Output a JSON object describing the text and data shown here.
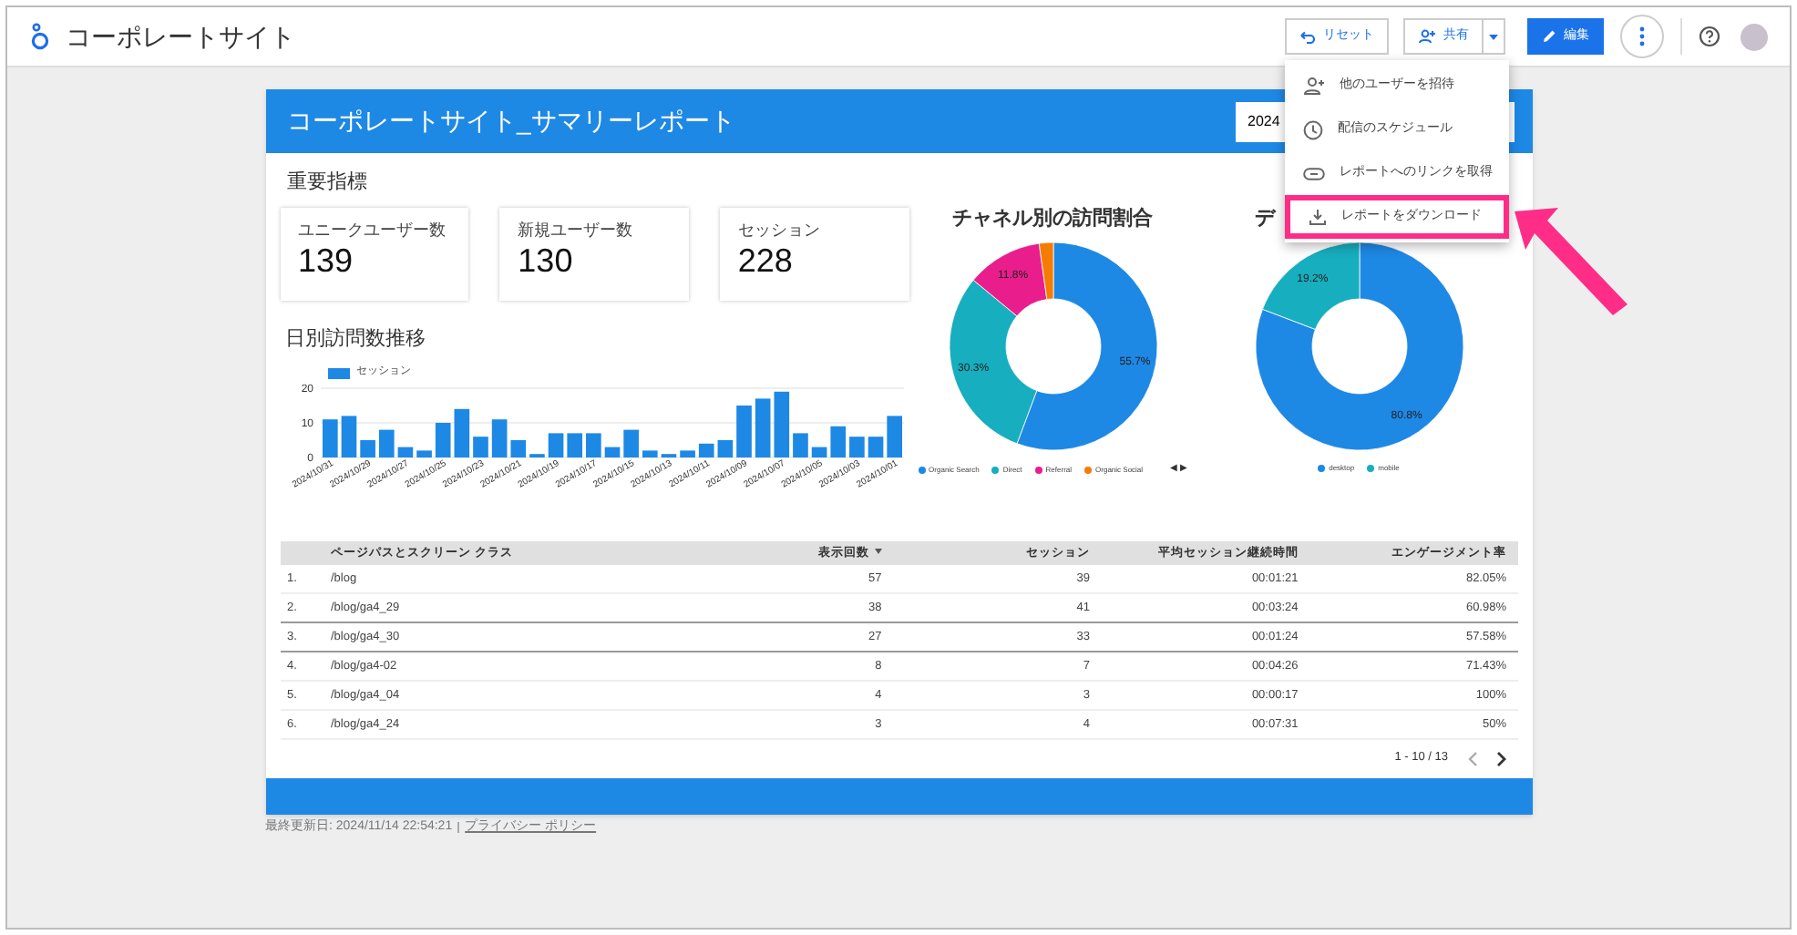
{
  "app_bar": {
    "title": "コーポレートサイト",
    "buttons": [
      {
        "kind": "reset",
        "label": "リセット"
      },
      {
        "kind": "share",
        "label": "共有"
      },
      {
        "kind": "edit",
        "label": "編集"
      }
    ]
  },
  "report": {
    "title": "コーポレートサイト_サマリーレポート",
    "date_range": "2024",
    "section_title": "重要指標",
    "scorecards": [
      {
        "label": "ユニークユーザー数",
        "value": "139"
      },
      {
        "label": "新規ユーザー数",
        "value": "130"
      },
      {
        "label": "セッション",
        "value": "228"
      }
    ],
    "bar_chart": {
      "title": "日別訪問数推移",
      "chart_data": {
        "type": "bar",
        "series": [
          {
            "name": "セッション",
            "color": "#1e88e5",
            "values": [
              11,
              12,
              5,
              8,
              3,
              2,
              10,
              14,
              6,
              11,
              5,
              1,
              7,
              7,
              7,
              3,
              8,
              2,
              1,
              2,
              4,
              5,
              15,
              17,
              19,
              7,
              3,
              9,
              6,
              6,
              12
            ]
          }
        ],
        "ylim": [
          0,
          20
        ],
        "yticks": [
          0,
          10,
          20
        ],
        "categories": [
          "2024/10/31",
          null,
          "2024/10/29",
          null,
          "2024/10/27",
          null,
          "2024/10/25",
          null,
          "2024/10/23",
          null,
          "2024/10/21",
          null,
          "2024/10/19",
          null,
          "2024/10/17",
          null,
          "2024/10/15",
          null,
          "2024/10/13",
          null,
          "2024/10/11",
          null,
          "2024/10/09",
          null,
          "2024/10/07",
          null,
          "2024/10/05",
          null,
          "2024/10/03",
          null,
          "2024/10/01"
        ]
      }
    },
    "donuts": [
      {
        "title": "チャネル別の訪問割合",
        "chart_data": {
          "type": "donut",
          "categories": [
            "Organic Search",
            "Direct",
            "Referral",
            "Organic Social"
          ],
          "values": [
            55.7,
            30.3,
            11.8,
            2.2
          ],
          "value_labels": [
            "55.7%",
            "30.3%",
            "11.8%",
            null
          ]
        },
        "slices": [
          {
            "color": "#1e88e5"
          },
          {
            "color": "#17aebf"
          },
          {
            "color": "#e91e8c"
          },
          {
            "color": "#f57c00"
          }
        ],
        "legend_pager": "◀ ▶"
      },
      {
        "title": "デ",
        "chart_data": {
          "type": "donut",
          "categories": [
            "desktop",
            "mobile"
          ],
          "values": [
            80.8,
            19.2
          ],
          "value_labels": [
            "80.8%",
            "19.2%"
          ]
        },
        "slices": [
          {
            "color": "#1e88e5"
          },
          {
            "color": "#17aebf"
          }
        ]
      }
    ],
    "table": {
      "columns": [
        {
          "label": "ページパスとスクリーン クラス",
          "sorted": false
        },
        {
          "label": "表示回数",
          "sorted": true
        },
        {
          "label": "セッション",
          "sorted": false
        },
        {
          "label": "平均セッション継続時間",
          "sorted": false
        },
        {
          "label": "エンゲージメント率",
          "sorted": false
        }
      ],
      "rows": [
        {
          "index": "1.",
          "cells": [
            "/blog",
            "57",
            "39",
            "00:01:21",
            "82.05%"
          ]
        },
        {
          "index": "2.",
          "cells": [
            "/blog/ga4_29",
            "38",
            "41",
            "00:03:24",
            "60.98%"
          ]
        },
        {
          "index": "3.",
          "cells": [
            "/blog/ga4_30",
            "27",
            "33",
            "00:01:24",
            "57.58%"
          ]
        },
        {
          "index": "4.",
          "cells": [
            "/blog/ga4-02",
            "8",
            "7",
            "00:04:26",
            "71.43%"
          ]
        },
        {
          "index": "5.",
          "cells": [
            "/blog/ga4_04",
            "4",
            "3",
            "00:00:17",
            "100%"
          ]
        },
        {
          "index": "6.",
          "cells": [
            "/blog/ga4_24",
            "3",
            "4",
            "00:07:31",
            "50%"
          ]
        }
      ],
      "pager": "1 - 10 / 13"
    }
  },
  "footer": {
    "last_updated": "最終更新日: 2024/11/14 22:54:21",
    "privacy_link": "プライバシー ポリシー"
  },
  "share_menu": {
    "items": [
      {
        "kind": "invite",
        "label": "他のユーザーを招待",
        "highlighted": false
      },
      {
        "kind": "schedule",
        "label": "配信のスケジュール",
        "highlighted": false
      },
      {
        "kind": "link",
        "label": "レポートへのリンクを取得",
        "highlighted": false
      },
      {
        "kind": "download",
        "label": "レポートをダウンロード",
        "highlighted": true
      }
    ]
  }
}
